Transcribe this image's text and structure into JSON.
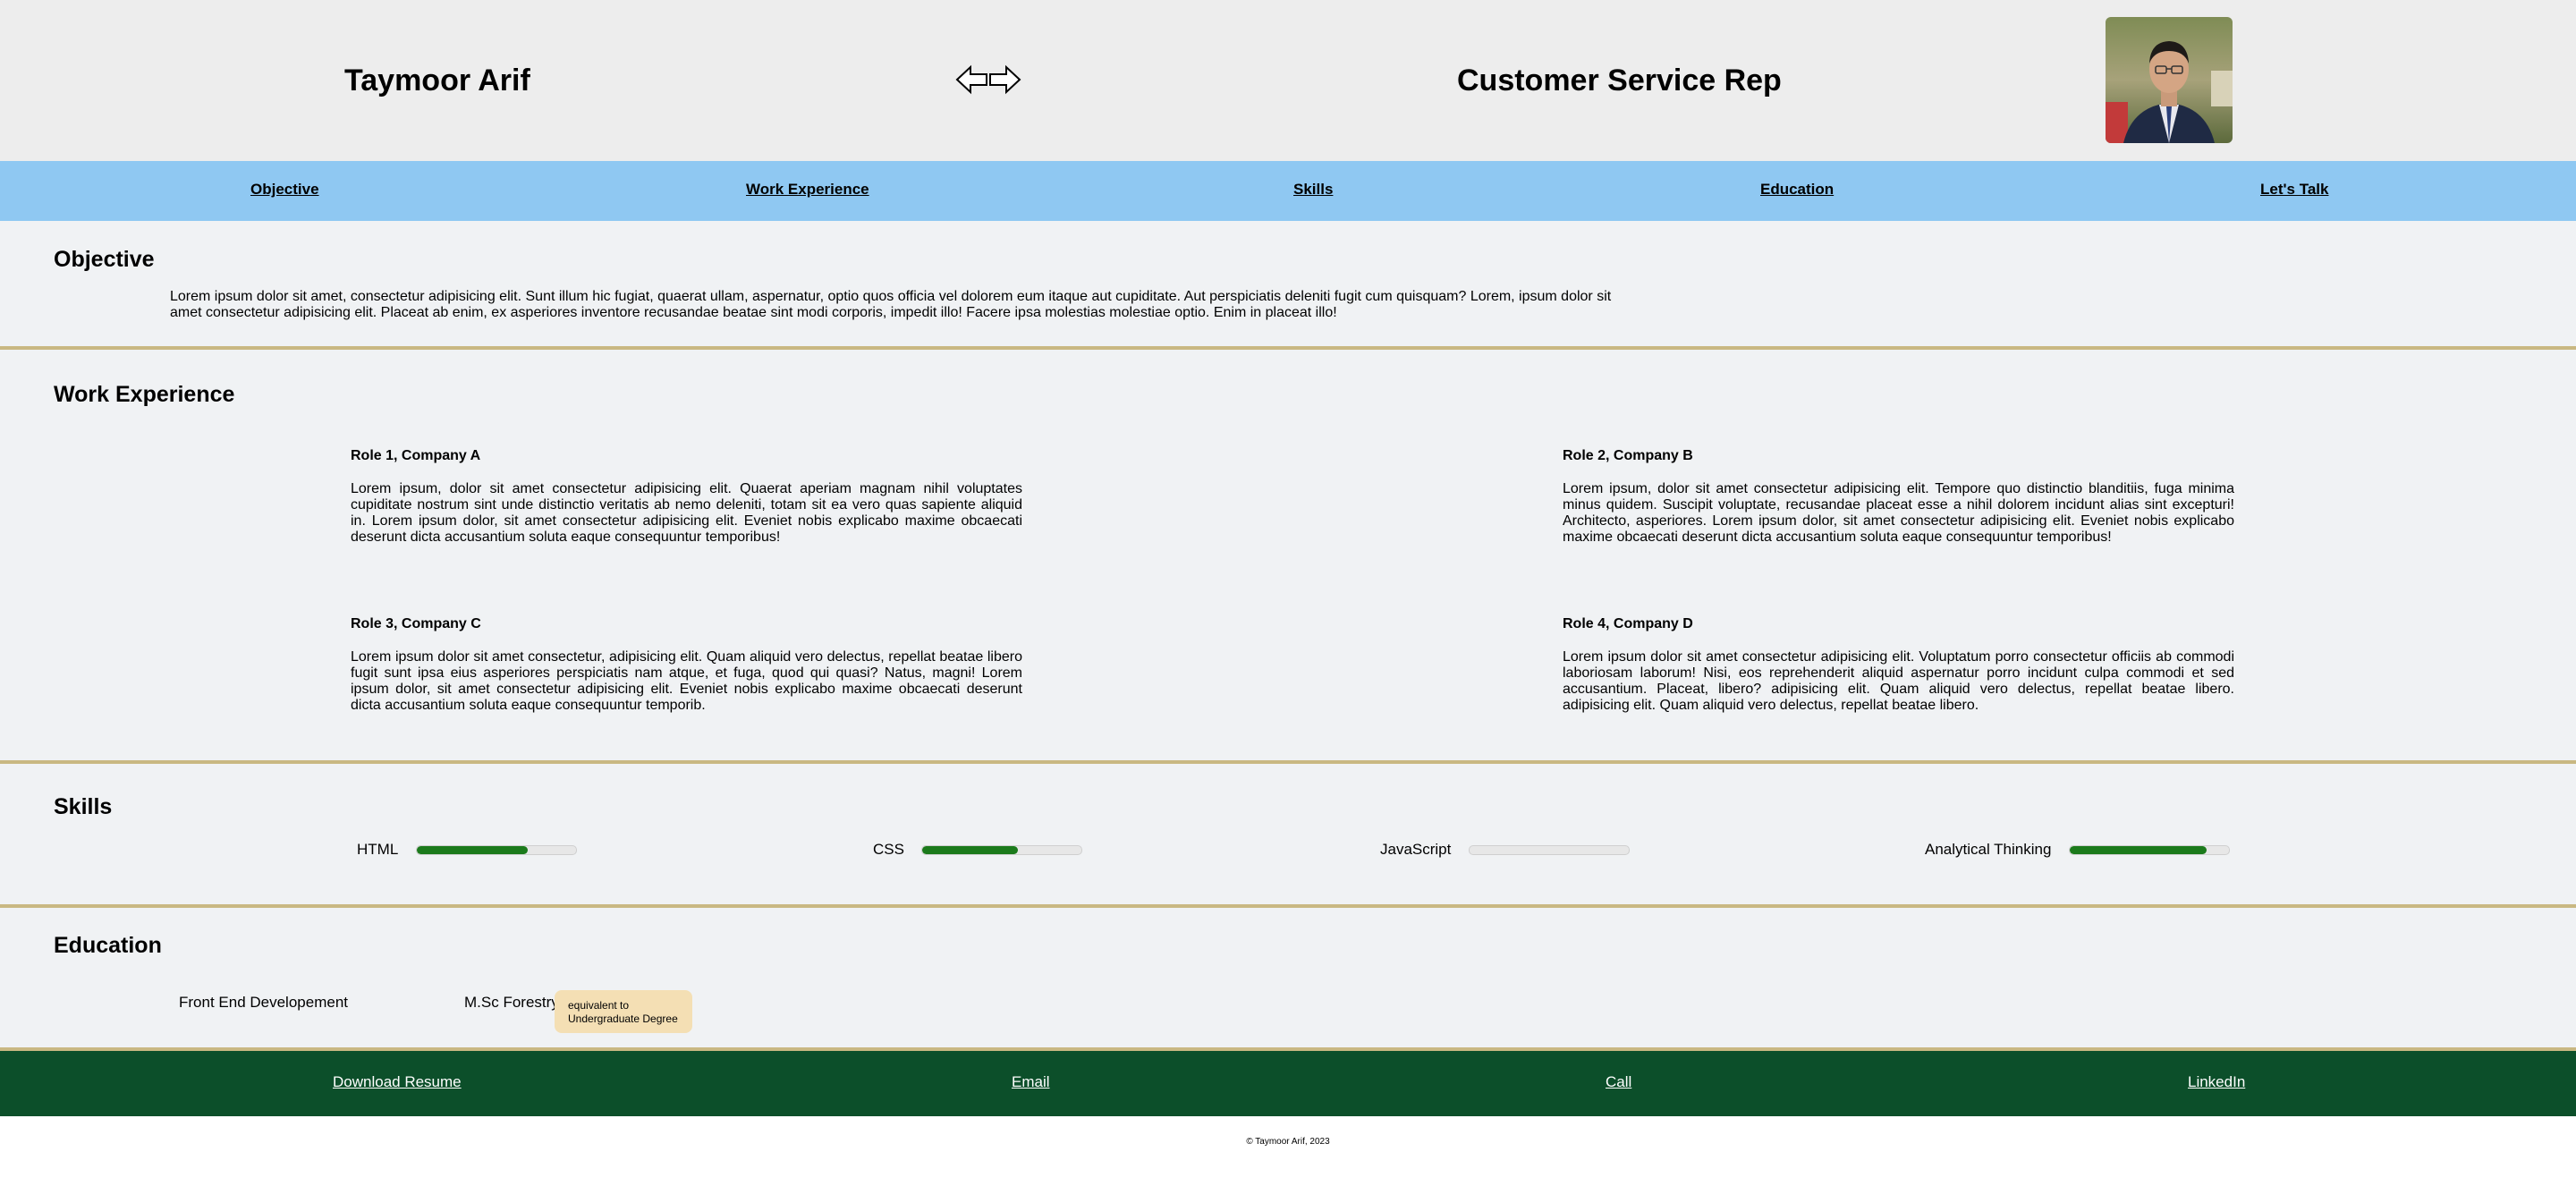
{
  "header": {
    "name": "Taymoor Arif",
    "role": "Customer Service Rep",
    "swap_icon": "arrows-left-right-icon",
    "avatar_alt": "profile-photo"
  },
  "nav": {
    "items": [
      "Objective",
      "Work Experience",
      "Skills",
      "Education",
      "Let's Talk"
    ]
  },
  "objective": {
    "heading": "Objective",
    "text": "Lorem ipsum dolor sit amet, consectetur adipisicing elit. Sunt illum hic fugiat, quaerat ullam, aspernatur, optio quos officia vel dolorem eum itaque aut cupiditate. Aut perspiciatis deleniti fugit cum quisquam? Lorem, ipsum dolor sit amet consectetur adipisicing elit. Placeat ab enim, ex asperiores inventore recusandae beatae sint modi corporis, impedit illo! Facere ipsa molestias molestiae optio. Enim in placeat illo!"
  },
  "work": {
    "heading": "Work Experience",
    "jobs": [
      {
        "title": "Role 1, Company A",
        "text": "Lorem ipsum, dolor sit amet consectetur adipisicing elit. Quaerat aperiam magnam nihil voluptates cupiditate nostrum sint unde distinctio veritatis ab nemo deleniti, totam sit ea vero quas sapiente aliquid in. Lorem ipsum dolor, sit amet consectetur adipisicing elit. Eveniet nobis explicabo maxime obcaecati deserunt dicta accusantium soluta eaque consequuntur temporibus!"
      },
      {
        "title": "Role 2, Company B",
        "text": "Lorem ipsum, dolor sit amet consectetur adipisicing elit. Tempore quo distinctio blanditiis, fuga minima minus quidem. Suscipit voluptate, recusandae placeat esse a nihil dolorem incidunt alias sint excepturi! Architecto, asperiores. Lorem ipsum dolor, sit amet consectetur adipisicing elit. Eveniet nobis explicabo maxime obcaecati deserunt dicta accusantium soluta eaque consequuntur temporibus!"
      },
      {
        "title": "Role 3, Company C",
        "text": "Lorem ipsum dolor sit amet consectetur, adipisicing elit. Quam aliquid vero delectus, repellat beatae libero fugit sunt ipsa eius asperiores perspiciatis nam atque, et fuga, quod qui quasi? Natus, magni! Lorem ipsum dolor, sit amet consectetur adipisicing elit. Eveniet nobis explicabo maxime obcaecati deserunt dicta accusantium soluta eaque consequuntur temporib."
      },
      {
        "title": "Role 4, Company D",
        "text": "Lorem ipsum dolor sit amet consectetur adipisicing elit. Voluptatum porro consectetur officiis ab commodi laboriosam laborum! Nisi, eos reprehenderit aliquid aspernatur porro incidunt culpa commodi et sed accusantium. Placeat, libero? adipisicing elit. Quam aliquid vero delectus, repellat beatae libero. adipisicing elit. Quam aliquid vero delectus, repellat beatae libero."
      }
    ]
  },
  "skills": {
    "heading": "Skills",
    "items": [
      {
        "label": "HTML",
        "level": 0.7
      },
      {
        "label": "CSS",
        "level": 0.6
      },
      {
        "label": "JavaScript",
        "level": 0
      },
      {
        "label": "Analytical Thinking",
        "level": 0.86
      }
    ],
    "bar_color": "#1b7a1b"
  },
  "education": {
    "heading": "Education",
    "items": [
      "Front End Developement",
      "M.Sc Forestry"
    ],
    "note": "equivalent to Undergraduate Degree"
  },
  "footer": {
    "links": [
      "Download Resume",
      "Email",
      "Call",
      "LinkedIn"
    ],
    "copyright": "© Taymoor Arif, 2023"
  },
  "colors": {
    "header_bg": "#ededed",
    "nav_bg": "#8fc8f2",
    "section_bg": "#f0f2f4",
    "divider": "#c9b882",
    "footer_bg": "#0c4f2a"
  }
}
